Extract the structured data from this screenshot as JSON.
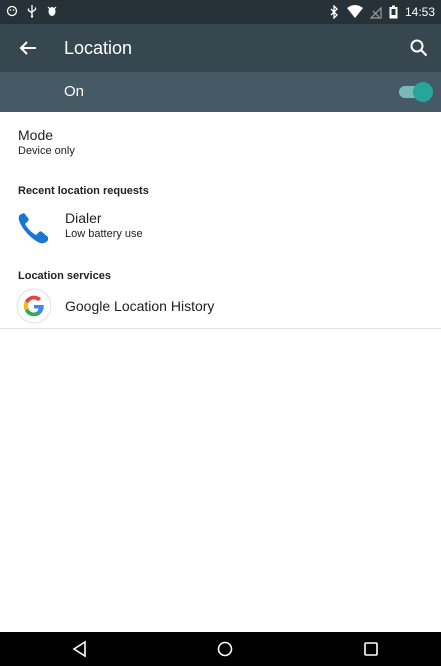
{
  "status_bar": {
    "time": "14:53",
    "icons_left": [
      "android-icon",
      "usb-icon",
      "debug-icon"
    ],
    "icons_right": [
      "bluetooth-icon",
      "wifi-icon",
      "no-signal-icon",
      "battery-icon"
    ]
  },
  "toolbar": {
    "title": "Location",
    "back_icon": "arrow-left-icon",
    "search_icon": "search-icon",
    "bg": "#37474f"
  },
  "master_switch": {
    "label": "On",
    "state": "on",
    "accent": "#26a69a"
  },
  "mode": {
    "title": "Mode",
    "value": "Device only"
  },
  "recent_requests": {
    "header": "Recent location requests",
    "items": [
      {
        "name": "Dialer",
        "detail": "Low battery use",
        "icon": "phone-icon"
      }
    ]
  },
  "location_services": {
    "header": "Location services",
    "items": [
      {
        "name": "Google Location History",
        "icon": "google-icon"
      }
    ]
  },
  "nav_bar": {
    "buttons": [
      "back-triangle-icon",
      "home-circle-icon",
      "recents-square-icon"
    ]
  }
}
